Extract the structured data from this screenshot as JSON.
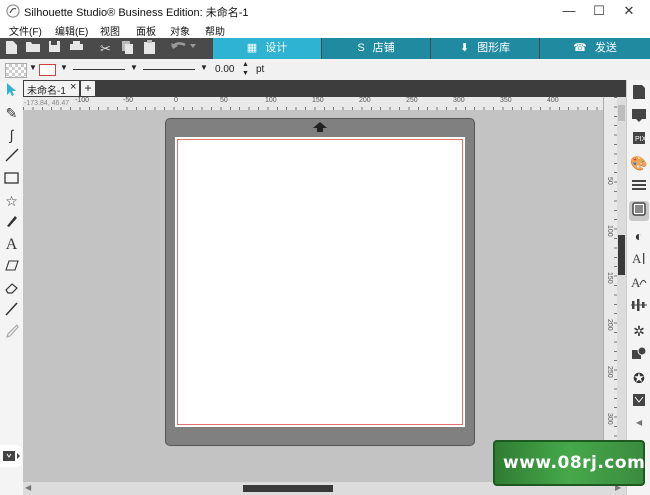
{
  "window": {
    "title": "Silhouette Studio® Business Edition: 未命名-1",
    "controls": [
      "—",
      "☐",
      "✕"
    ]
  },
  "menu": [
    "文件(F)",
    "编辑(E)",
    "视图",
    "面板",
    "对象",
    "帮助"
  ],
  "tabs": [
    {
      "label": "设计",
      "icon": "▦",
      "active": true
    },
    {
      "label": "店铺",
      "icon": "S",
      "active": false
    },
    {
      "label": "图形库",
      "icon": "⬇",
      "active": false
    },
    {
      "label": "发送",
      "icon": "☎",
      "active": false
    }
  ],
  "props": {
    "line_width_value": "0.00",
    "unit": "pt"
  },
  "document": {
    "tab_label": "未命名-1",
    "close_glyph": "×",
    "add_glyph": "+",
    "coords": "-173.84, 46.47"
  },
  "ruler": {
    "h_ticks": [
      "-100",
      "-50",
      "0",
      "50",
      "100",
      "150",
      "200",
      "250",
      "300",
      "350",
      "400"
    ],
    "v_ticks": [
      "50",
      "100",
      "150",
      "200",
      "250",
      "300"
    ]
  },
  "watermark": {
    "text": "www.08rj.com"
  },
  "colors": {
    "toolbar_bg": "#4a4a4a",
    "tab_active": "#2fb3d2",
    "tab_inactive": "#1f8aa0",
    "mat": "#808080",
    "canvas": "#c3c3c3"
  }
}
